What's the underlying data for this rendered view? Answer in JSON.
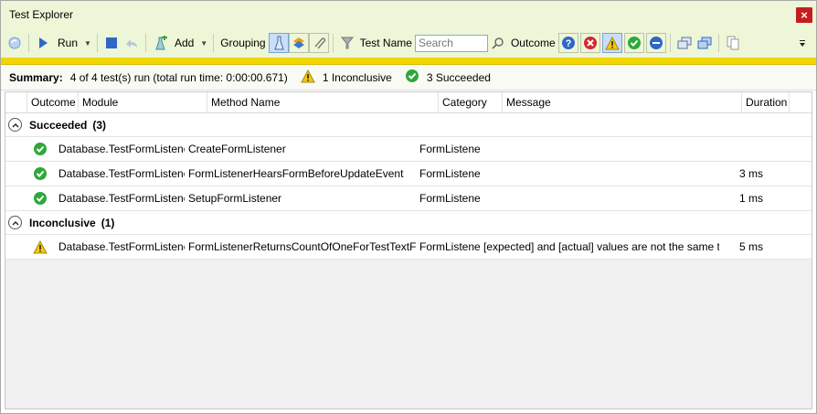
{
  "window": {
    "title": "Test Explorer",
    "close_glyph": "×"
  },
  "toolbar": {
    "run_label": "Run",
    "add_label": "Add",
    "grouping_label": "Grouping",
    "test_name_label": "Test Name",
    "search_placeholder": "Search",
    "outcome_label": "Outcome"
  },
  "summary": {
    "label": "Summary:",
    "run_text": "4 of 4 test(s) run (total run time: 0:00:00.671)",
    "inconclusive_text": "1 Inconclusive",
    "succeeded_text": "3 Succeeded"
  },
  "columns": [
    "Outcome",
    "Module",
    "Method Name",
    "Category",
    "Message",
    "Duration"
  ],
  "groups": [
    {
      "name": "Succeeded",
      "count": "(3)",
      "rows": [
        {
          "outcome": "passed",
          "module": "Database.TestFormListener",
          "method": "CreateFormListener",
          "category": "FormListener",
          "message": "",
          "duration": ""
        },
        {
          "outcome": "passed",
          "module": "Database.TestFormListener",
          "method": "FormListenerHearsFormBeforeUpdateEvent",
          "category": "FormListener",
          "message": "",
          "duration": "3 ms"
        },
        {
          "outcome": "passed",
          "module": "Database.TestFormListener",
          "method": "SetupFormListener",
          "category": "FormListener",
          "message": "",
          "duration": "1 ms"
        }
      ]
    },
    {
      "name": "Inconclusive",
      "count": "(1)",
      "rows": [
        {
          "outcome": "inconclusive",
          "module": "Database.TestFormListener",
          "method": "FormListenerReturnsCountOfOneForTestTextField",
          "category": "FormListener",
          "message": "[expected] and [actual] values are not the same type.",
          "duration": "5 ms"
        }
      ]
    }
  ],
  "colors": {
    "title_bg": "#eef6d8",
    "progress_bar": "#f2d600",
    "pass_green": "#2fa83a",
    "warn_yellow": "#f2c811",
    "fail_red": "#d42a2a",
    "info_blue": "#2f67c7"
  },
  "icons": {
    "refresh": "refresh-icon",
    "run": "run-play-icon",
    "stop": "stop-icon",
    "cancel": "cancel-undo-icon",
    "add": "add-test-icon",
    "group_by_category": "group-by-category-icon",
    "group_by_class": "group-by-class-icon",
    "group_by_attachment": "group-by-attachment-icon",
    "filter": "filter-funnel-icon",
    "search": "search-icon",
    "outcome_unknown": "question-icon",
    "outcome_failed": "failed-icon",
    "outcome_inconclusive": "warning-icon",
    "outcome_passed": "passed-icon",
    "outcome_not_run": "not-run-icon",
    "collapse_all": "collapse-all-icon",
    "expand_all": "expand-all-icon",
    "copy": "copy-icon",
    "overflow": "overflow-icon"
  }
}
